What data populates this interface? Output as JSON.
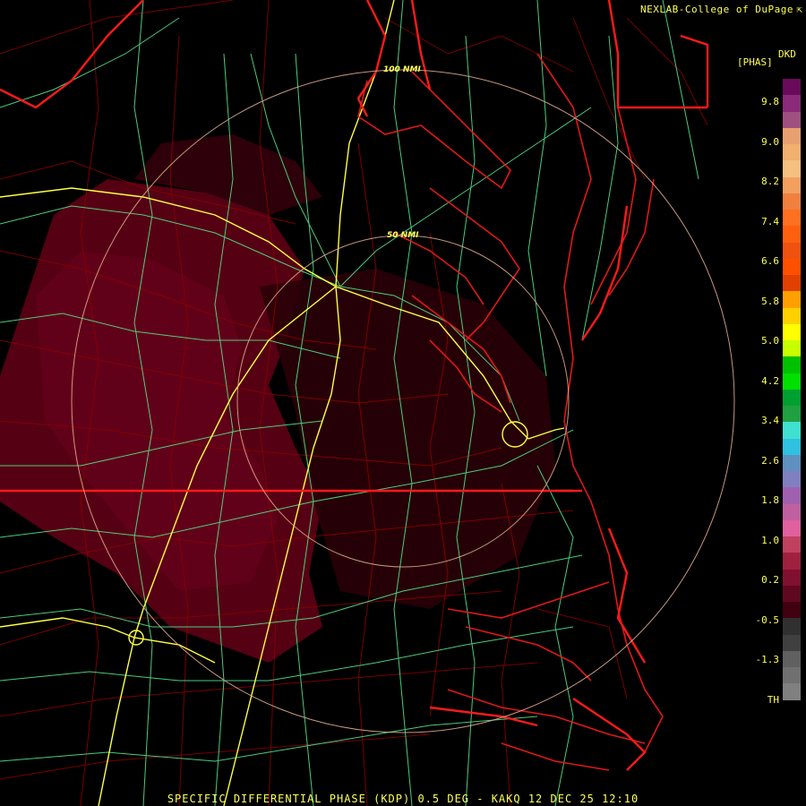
{
  "header": {
    "credit": "NEXLAB-College of DuPage",
    "credit_icon": "external-link-icon"
  },
  "footer": {
    "caption": "SPECIFIC DIFFERENTIAL PHASE (KDP) 0.5 DEG - KAKQ 12 DEC 25 12:10"
  },
  "range_rings": {
    "outer": "100 NMI",
    "inner": "50 NMI"
  },
  "legend": {
    "product": "DKD",
    "units": "[PHAS]",
    "labels": [
      "9.8",
      "9.0",
      "8.2",
      "7.4",
      "6.6",
      "5.8",
      "5.0",
      "4.2",
      "3.4",
      "2.6",
      "1.8",
      "1.0",
      "0.2",
      "-0.5",
      "-1.3",
      "TH"
    ],
    "colors": [
      "#6a0a5a",
      "#8a2a78",
      "#a05080",
      "#e8a070",
      "#f0b070",
      "#f5c080",
      "#f2a060",
      "#f08040",
      "#ff7020",
      "#ff6010",
      "#f05010",
      "#ff5000",
      "#e04000",
      "#ffa000",
      "#ffd000",
      "#ffff00",
      "#c8ff00",
      "#00c000",
      "#00e000",
      "#00a030",
      "#20a040",
      "#40e0d0",
      "#30c0e0",
      "#6090c0",
      "#8080c0",
      "#a060b0",
      "#c060a0",
      "#e060a0",
      "#c04060",
      "#a02040",
      "#801030",
      "#600820",
      "#400010",
      "#303030",
      "#404040",
      "#606060",
      "#707070",
      "#808080",
      "#000000"
    ]
  },
  "map": {
    "colors": {
      "county": "#8b0000",
      "state": "#ff1a1a",
      "coast": "#e01818",
      "highway": "#55e08a",
      "interstate": "#ffff44",
      "ring": "#e6b090",
      "echo": "#5a0014"
    }
  }
}
